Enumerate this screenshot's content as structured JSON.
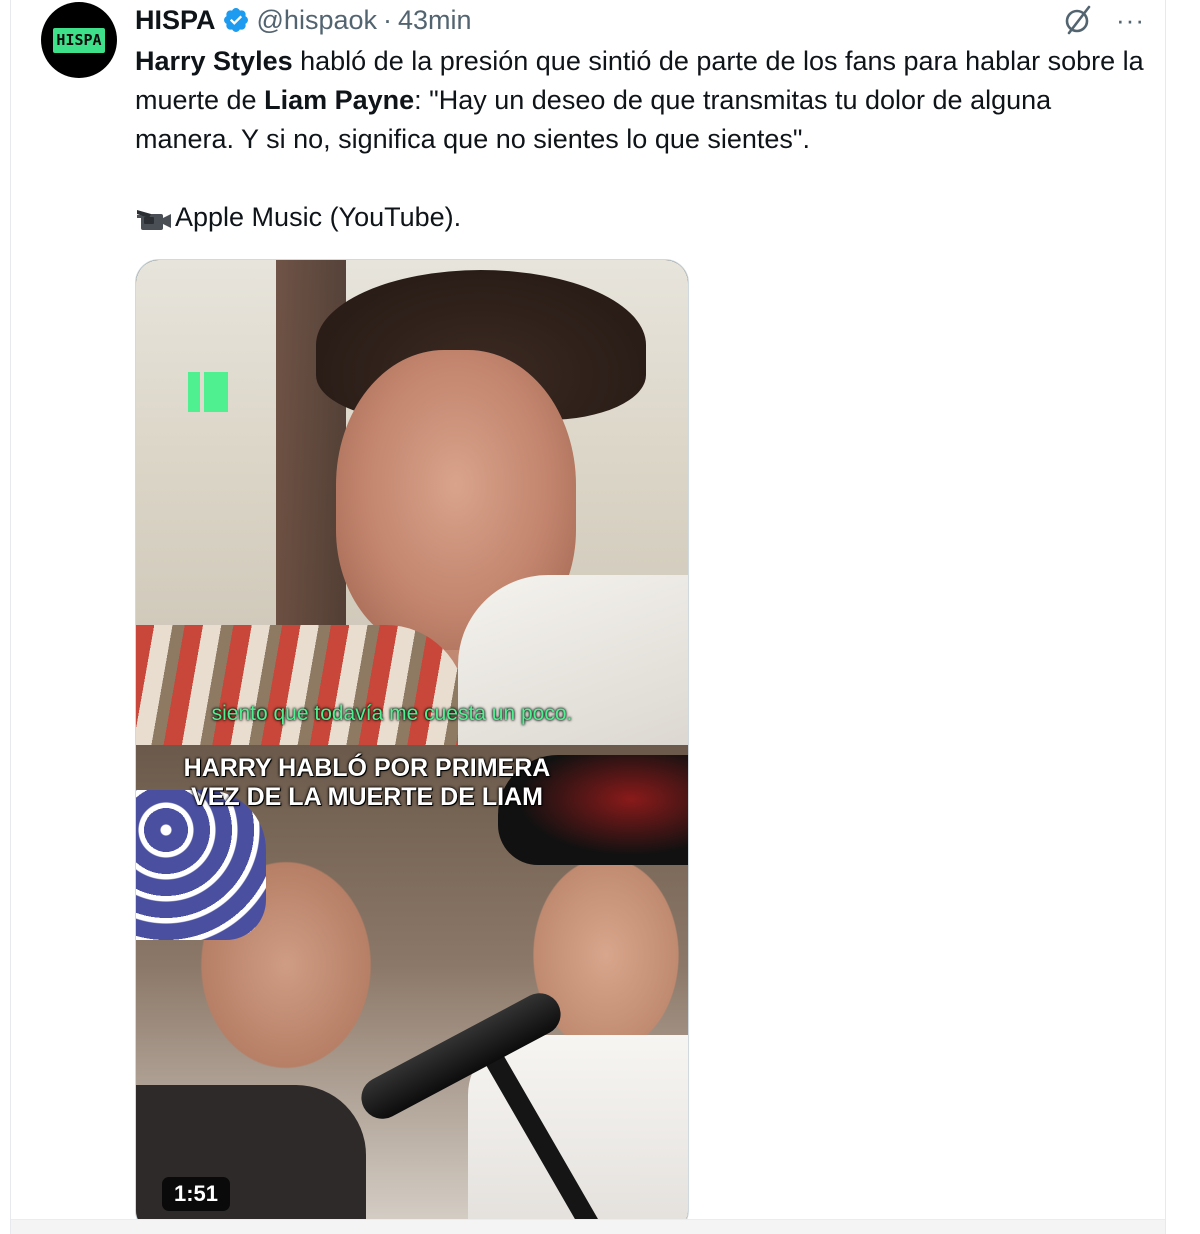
{
  "tweet": {
    "author_name": "HISPA",
    "avatar_text": "HISPA",
    "handle": "@hispaok",
    "separator": "·",
    "time": "43min",
    "text": {
      "line_a_bold": "Harry Styles",
      "line_a_rest": " habló de la presión que sintió de parte de los fans para hablar sobre la muerte de ",
      "line_b_bold": "Liam Payne",
      "line_b_rest": ": \"Hay un deseo de que transmitas tu dolor de alguna manera. Y si no, significa que no sientes lo que sientes\"."
    },
    "source": "Apple Music (YouTube).",
    "more_label": "···"
  },
  "media": {
    "subtitle": "siento que todavía me cuesta un poco.",
    "headline_line1": "HARRY HABLÓ POR PRIMERA",
    "headline_line2": "VEZ DE LA MUERTE DE LIAM",
    "duration": "1:51"
  },
  "colors": {
    "accent_green": "#4ef08f",
    "verified_blue": "#1d9bf0",
    "secondary_text": "#536471"
  },
  "icons": {
    "verified": "verified-badge-icon",
    "grok": "grok-slash-icon",
    "more": "more-dots-icon",
    "camera": "video-camera-icon"
  }
}
